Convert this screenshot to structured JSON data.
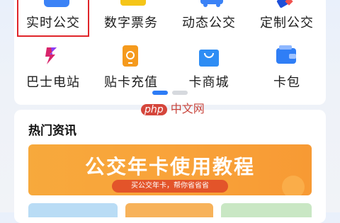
{
  "services": {
    "row1": [
      {
        "label": "实时公交",
        "icon": "bus-icon"
      },
      {
        "label": "数字票务",
        "icon": "ticket-icon"
      },
      {
        "label": "动态公交",
        "icon": "dynamic-bus-icon"
      },
      {
        "label": "定制公交",
        "icon": "custom-bus-icon"
      }
    ],
    "row2": [
      {
        "label": "巴士电站",
        "icon": "lightning-icon"
      },
      {
        "label": "贴卡充值",
        "icon": "card-recharge-icon"
      },
      {
        "label": "卡商城",
        "icon": "shopping-bag-icon"
      },
      {
        "label": "卡包",
        "icon": "wallet-icon"
      }
    ]
  },
  "pager": {
    "pages": 2,
    "active": 1
  },
  "watermark": {
    "brand": "php",
    "text": "中文网"
  },
  "news": {
    "title": "热门资讯",
    "banner_title": "公交年卡使用教程",
    "banner_subtitle": "买公交年卡，帮你省省省"
  },
  "colors": {
    "highlight": "#e0252a",
    "accent": "#2d7cf6",
    "banner": "#f9a33a"
  }
}
